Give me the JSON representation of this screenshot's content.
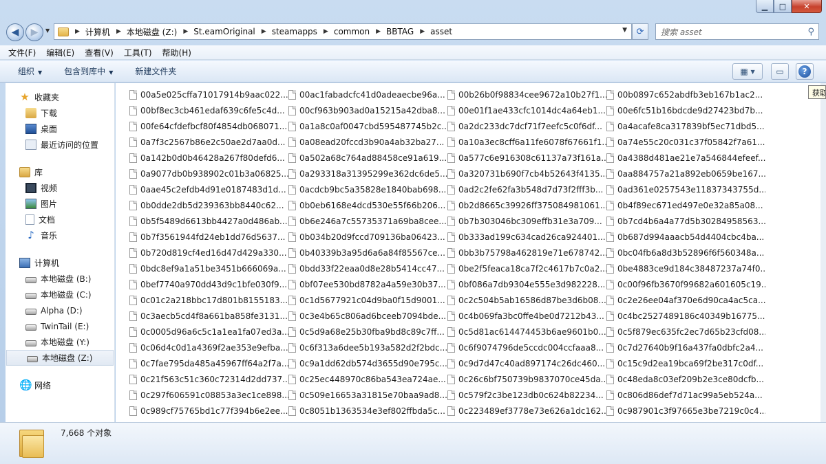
{
  "window": {
    "caption_buttons": {
      "minimize": "▁",
      "maximize": "□",
      "close": "✕"
    }
  },
  "nav": {
    "back_glyph": "◀",
    "forward_glyph": "▶",
    "breadcrumbs": [
      "计算机",
      "本地磁盘 (Z:)",
      "St.eamOriginal",
      "steamapps",
      "common",
      "BBTAG",
      "asset"
    ],
    "refresh_glyph": "⟳"
  },
  "search": {
    "placeholder": "搜索 asset",
    "icon": "search-icon"
  },
  "menubar": [
    "文件(F)",
    "编辑(E)",
    "查看(V)",
    "工具(T)",
    "帮助(H)"
  ],
  "toolbar": {
    "organize": "组织",
    "include_library": "包含到库中",
    "new_folder": "新建文件夹",
    "help": "?"
  },
  "navpane": {
    "favorites": {
      "label": "收藏夹",
      "items": [
        "下载",
        "桌面",
        "最近访问的位置"
      ]
    },
    "libraries": {
      "label": "库",
      "items": [
        "视频",
        "图片",
        "文档",
        "音乐"
      ]
    },
    "computer": {
      "label": "计算机",
      "items": [
        "本地磁盘 (B:)",
        "本地磁盘 (C:)",
        "Alpha (D:)",
        "TwinTail (E:)",
        "本地磁盘 (Y:)",
        "本地磁盘 (Z:)"
      ],
      "selected": "本地磁盘 (Z:)"
    },
    "network": {
      "label": "网络"
    }
  },
  "files": [
    "00a5e025cffa71017914b9aac022...",
    "00ac1fabadcfc41d0adeaecbe96a...",
    "00b26b0f98834cee9672a10b27f1...",
    "00b0897c652abdfb3eb167b1ac2...",
    "00bf8ec3cb461edaf639c6fe5c4d...",
    "00cf963b903ad0a15215a42dba8...",
    "00e01f1ae433cfc1014dc4a64eb1...",
    "00e6fc51b16bdcde9d27423bd7b...",
    "00fe64cfdefbcf80f4854db068071...",
    "0a1a8c0af0047cbd595487745b2c...",
    "0a2dc233dc7dcf71f7eefc5c0f6df...",
    "0a4acafe8ca317839bf5ec71dbd5...",
    "0a7f3c2567b86e2c50ae2d7aa0d...",
    "0a08ead20fccd3b90a4ab32ba27...",
    "0a10a3ec8cff6a11fe6078f67661f1...",
    "0a74e55c20c031c37f05842f7a61...",
    "0a142b0d0b46428a267f80defd6...",
    "0a502a68c764ad88458ce91a619...",
    "0a577c6e916308c61137a73f161a...",
    "0a4388d481ae21e7a546844efeef...",
    "0a9077db0b938902c01b3a06825...",
    "0a293318a31395299e362dc6de5...",
    "0a320731b690f7cb4b52643f4135...",
    "0aa884757a21a892eb0659be167...",
    "0aae45c2efdb4d91e0187483d1d...",
    "0acdcb9bc5a35828e1840bab698...",
    "0ad2c2fe62fa3b548d7d73f2fff3b...",
    "0ad361e0257543e11837343755d...",
    "0b0dde2db5d239363bb8440c62...",
    "0b0eb6168e4dcd530e55f66b206...",
    "0b2d8665c39926ff375084981061...",
    "0b4f89ec671ed497e0e32a85a08...",
    "0b5f5489d6613bb4427a0d486ab...",
    "0b6e246a7c55735371a69ba8cee...",
    "0b7b303046bc309effb31e3a709...",
    "0b7cd4b6a4a77d5b30284958563...",
    "0b7f3561944fd24eb1dd76d5637...",
    "0b034b20d9fccd709136ba06423...",
    "0b333ad199c634cad26ca924401...",
    "0b687d994aaacb54d4404cbc4ba...",
    "0b720d819cf4ed16d47d429a330...",
    "0b40339b3a95d6a6a84f85567ce...",
    "0bb3b75798a462819e71e678742...",
    "0bc04fb6a8d3b52896f6f560348a...",
    "0bdc8ef9a1a51be3451b666069a...",
    "0bdd33f22eaa0d8e28b5414cc47...",
    "0be2f5feaca18ca7f2c4617b7c0a2...",
    "0be4883ce9d184c38487237a74f0...",
    "0bef7740a970dd43d9c1bfe030f9...",
    "0bf07ee530bd8782a4a59e30b37...",
    "0bf086a7db9304e555e3d982228...",
    "0c00f96fb3670f99682a601605c19...",
    "0c01c2a218bbc17d801b8155183...",
    "0c1d5677921c04d9ba0f15d9001...",
    "0c2c504b5ab16586d87be3d6b08...",
    "0c2e26ee04af370e6d90ca4ac5ca...",
    "0c3aecb5cd4f8a661ba858fe3131...",
    "0c3e4b65c806ad6bceeb7094bde...",
    "0c4b069fa3bc0ffe4be0d7212b43...",
    "0c4bc2527489186c40349b16775...",
    "0c0005d96a6c5c1a1ea1fa07ed3a...",
    "0c5d9a68e25b30fba9bd8c89c7ff...",
    "0c5d81ac614474453b6ae9601b0...",
    "0c5f879ec635fc2ec7d65b23cfd08...",
    "0c06d4c0d1a4369f2ae353e9efba...",
    "0c6f313a6dee5b193a582d2f2bdc...",
    "0c6f9074796de5ccdc004ccfaaa8...",
    "0c7d27640b9f16a437fa0dbfc2a4...",
    "0c7fae795da485a45967ff64a2f7a...",
    "0c9a1dd62db574d3655d90e795c...",
    "0c9d7d47c40ad897174c26dc460...",
    "0c15c9d2ea19bca69f2be317c0df...",
    "0c21f563c51c360c72314d2dd737...",
    "0c25ec448970c86ba543ea724ae...",
    "0c26c6bf750739b9837070ce45da...",
    "0c48eda8c03ef209b2e3ce80dcfb...",
    "0c297f606591c08853a3ec1ce898...",
    "0c509e16653a31815e70baa9ad8...",
    "0c579f2c3be123db0c624b82234...",
    "0c806d86def7d71ac99a5eb524a...",
    "0c989cf75765bd1c77f394b6e2ee...",
    "0c8051b1363534e3ef802ffbda5c...",
    "0c223489ef3778e73e626a1dc162...",
    "0c987901c3f97665e3be7219c0c4..."
  ],
  "tooltip": "获取",
  "status": {
    "count": "7,668 个对象"
  }
}
